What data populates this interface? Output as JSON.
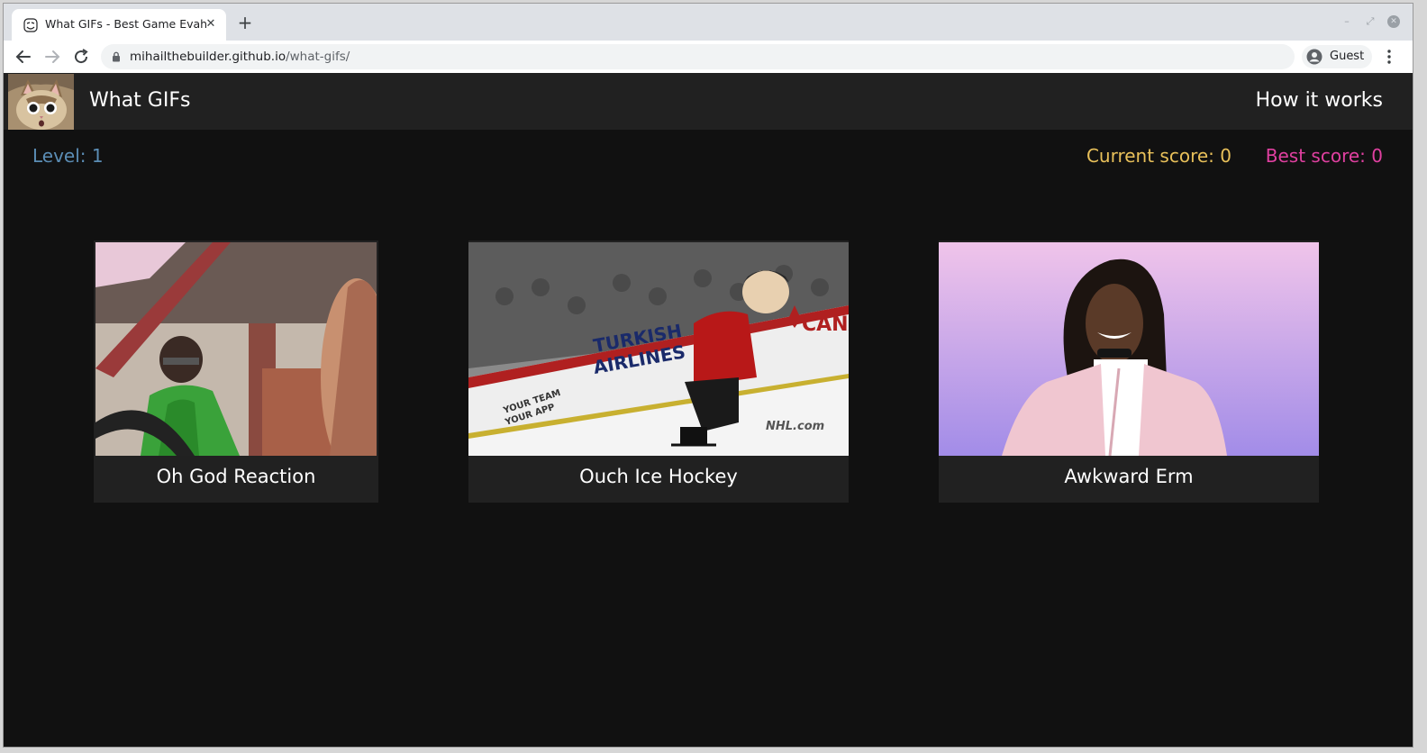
{
  "browser": {
    "tab_title": "What GIFs - Best Game Evah",
    "url_host": "mihailthebuilder.github.io",
    "url_path": "/what-gifs/",
    "profile_label": "Guest",
    "tab_close_glyph": "✕",
    "new_tab_glyph": "+",
    "window_controls": [
      "–",
      "⤢",
      "✕"
    ]
  },
  "header": {
    "logo_icon": "surprised-cat-logo",
    "title": "What GIFs",
    "how_it_works": "How it works"
  },
  "scoreboard": {
    "level": "Level: 1",
    "current_score": "Current score: 0",
    "best_score": "Best score: 0"
  },
  "cards": [
    {
      "label": "Oh God Reaction",
      "image": "gif-man-in-car-green-shirt"
    },
    {
      "label": "Ouch Ice Hockey",
      "image": "gif-hockey-mascot-on-ice"
    },
    {
      "label": "Awkward Erm",
      "image": "gif-woman-pink-jacket"
    }
  ],
  "rink_ads": {
    "board_text_1": "TURKISH",
    "board_text_2": "AIRLINES",
    "side_text_1": "YOUR TEAM",
    "side_text_2": "YOUR APP",
    "nhl": "NHL.com",
    "banner": "CANA"
  },
  "colors": {
    "level": "#5b8db5",
    "current_score": "#e8c05a",
    "best_score": "#e040a0",
    "header_bg": "#212121",
    "page_bg": "#111111"
  }
}
